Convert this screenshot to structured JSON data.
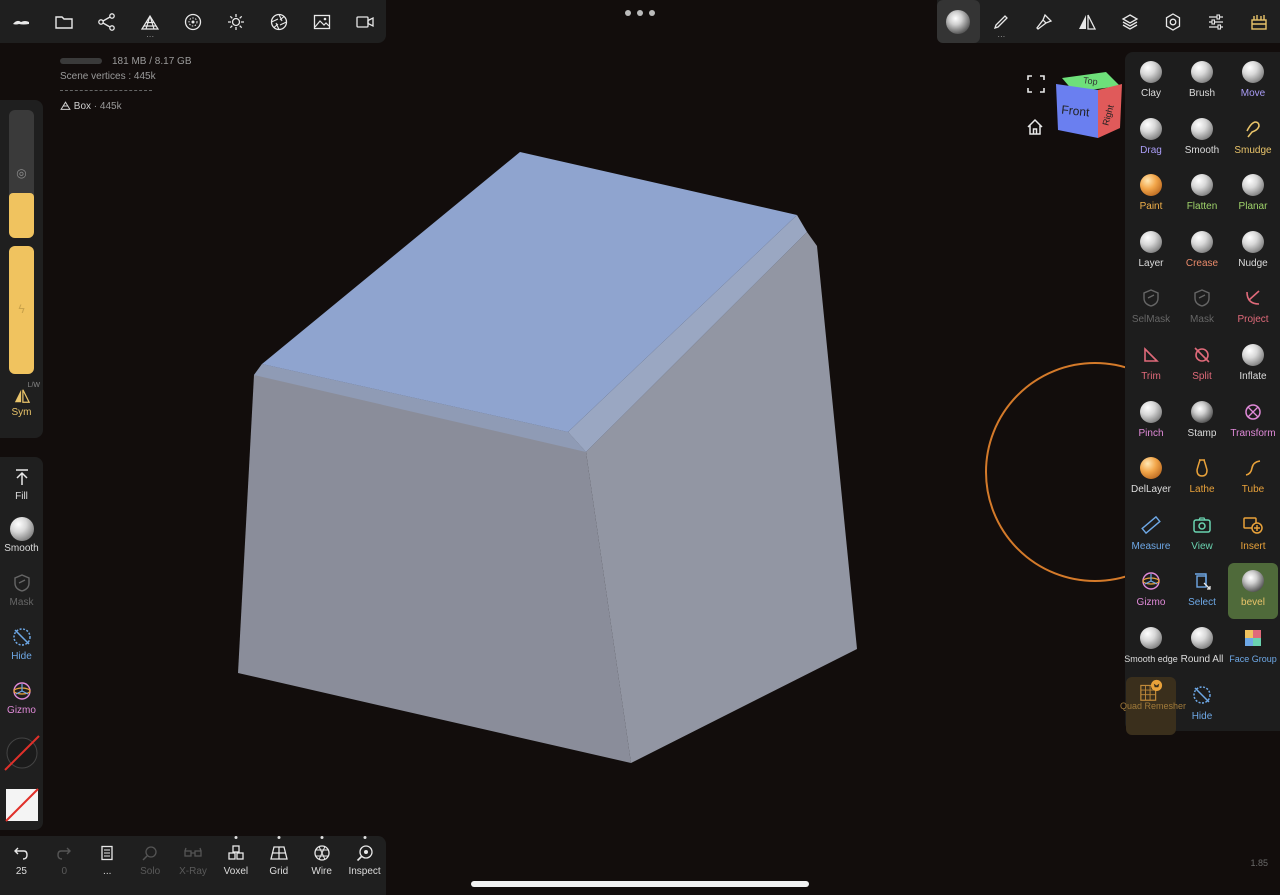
{
  "scene": {
    "memory": "181 MB / 8.17 GB",
    "vertices": "Scene vertices : 445k",
    "object_name": "Box",
    "object_count": "· 445k"
  },
  "top_left_toolbar": [
    {
      "name": "nomad-logo-icon"
    },
    {
      "name": "folder-icon"
    },
    {
      "name": "scene-graph-icon"
    },
    {
      "name": "topology-icon",
      "has_dots": true
    },
    {
      "name": "material-icon"
    },
    {
      "name": "light-icon"
    },
    {
      "name": "camera-aperture-icon"
    },
    {
      "name": "background-image-icon"
    },
    {
      "name": "video-icon"
    }
  ],
  "top_right_toolbar": [
    {
      "name": "current-tool-icon",
      "active": true
    },
    {
      "name": "brush-stroke-icon",
      "has_dots": true
    },
    {
      "name": "paint-icon"
    },
    {
      "name": "symmetry-icon"
    },
    {
      "name": "layers-icon"
    },
    {
      "name": "settings-icon"
    },
    {
      "name": "sliders-icon"
    },
    {
      "name": "toolbox-icon"
    }
  ],
  "left_sliders": {
    "radius_fill": 0.35,
    "intensity_fill": 1.0,
    "sym_label": "Sym",
    "sym_tag": "L/W"
  },
  "left_tools": [
    {
      "label": "Fill",
      "color": "#dcdcdc"
    },
    {
      "label": "Smooth",
      "color": "#dcdcdc"
    },
    {
      "label": "Mask",
      "color": "#666666"
    },
    {
      "label": "Hide",
      "color": "#6ea8e6"
    },
    {
      "label": "Gizmo",
      "color": "#e08ad8"
    }
  ],
  "bottom_bar": [
    {
      "label": "25",
      "name": "undo",
      "enabled": true,
      "sub": "undo"
    },
    {
      "label": "0",
      "name": "redo",
      "enabled": false
    },
    {
      "label": "...",
      "name": "notebook",
      "enabled": true
    },
    {
      "label": "Solo",
      "enabled": false
    },
    {
      "label": "X-Ray",
      "enabled": false
    },
    {
      "label": "Voxel",
      "enabled": true
    },
    {
      "label": "Grid",
      "enabled": true
    },
    {
      "label": "Wire",
      "enabled": true
    },
    {
      "label": "Inspect",
      "enabled": true
    }
  ],
  "version": "1.85",
  "view_cube": {
    "top": "Top",
    "front": "Front",
    "right": "Right"
  },
  "tools": [
    {
      "label": "Clay",
      "color": "#dcdcdc",
      "icon": "sphere"
    },
    {
      "label": "Brush",
      "color": "#dcdcdc",
      "icon": "sphere"
    },
    {
      "label": "Move",
      "color": "#a99cf5",
      "icon": "sphere"
    },
    {
      "label": "Drag",
      "color": "#a99cf5",
      "icon": "sphere"
    },
    {
      "label": "Smooth",
      "color": "#dcdcdc",
      "icon": "sphere"
    },
    {
      "label": "Smudge",
      "color": "#e9c46a",
      "icon": "smudge"
    },
    {
      "label": "Paint",
      "color": "#f0b04a",
      "icon": "sphere-gold"
    },
    {
      "label": "Flatten",
      "color": "#9fd36a",
      "icon": "sphere"
    },
    {
      "label": "Planar",
      "color": "#9fd36a",
      "icon": "sphere"
    },
    {
      "label": "Layer",
      "color": "#dcdcdc",
      "icon": "sphere"
    },
    {
      "label": "Crease",
      "color": "#e98a6a",
      "icon": "sphere"
    },
    {
      "label": "Nudge",
      "color": "#dcdcdc",
      "icon": "sphere"
    },
    {
      "label": "SelMask",
      "color": "#666666",
      "icon": "shield"
    },
    {
      "label": "Mask",
      "color": "#666666",
      "icon": "shield"
    },
    {
      "label": "Project",
      "color": "#e06a7a",
      "icon": "project"
    },
    {
      "label": "Trim",
      "color": "#e06a7a",
      "icon": "trim"
    },
    {
      "label": "Split",
      "color": "#e06a7a",
      "icon": "split"
    },
    {
      "label": "Inflate",
      "color": "#dcdcdc",
      "icon": "sphere"
    },
    {
      "label": "Pinch",
      "color": "#e08ad8",
      "icon": "sphere"
    },
    {
      "label": "Stamp",
      "color": "#dcdcdc",
      "icon": "sphere-dark"
    },
    {
      "label": "Transform",
      "color": "#e08ad8",
      "icon": "transform"
    },
    {
      "label": "DelLayer",
      "color": "#dcdcdc",
      "icon": "sphere-gold"
    },
    {
      "label": "Lathe",
      "color": "#e9a23a",
      "icon": "lathe"
    },
    {
      "label": "Tube",
      "color": "#e9a23a",
      "icon": "tube"
    },
    {
      "label": "Measure",
      "color": "#6ea8e6",
      "icon": "measure"
    },
    {
      "label": "View",
      "color": "#6ad3b0",
      "icon": "view"
    },
    {
      "label": "Insert",
      "color": "#e9a23a",
      "icon": "insert"
    },
    {
      "label": "Gizmo",
      "color": "#e08ad8",
      "icon": "gizmo"
    },
    {
      "label": "Select",
      "color": "#6ea8e6",
      "icon": "select"
    },
    {
      "label": "bevel",
      "color": "#e9c46a",
      "icon": "sphere-dark",
      "selected": true
    },
    {
      "label": "Smooth edge",
      "color": "#dcdcdc",
      "icon": "sphere"
    },
    {
      "label": "Round All",
      "color": "#dcdcdc",
      "icon": "sphere"
    },
    {
      "label": "Face Group",
      "color": "#6ea8e6",
      "icon": "facegroup"
    },
    {
      "label": "Quad Remesher",
      "color": "#a07a3a",
      "icon": "quad",
      "quad": true
    },
    {
      "label": "Hide",
      "color": "#6ea8e6",
      "icon": "hide"
    }
  ]
}
